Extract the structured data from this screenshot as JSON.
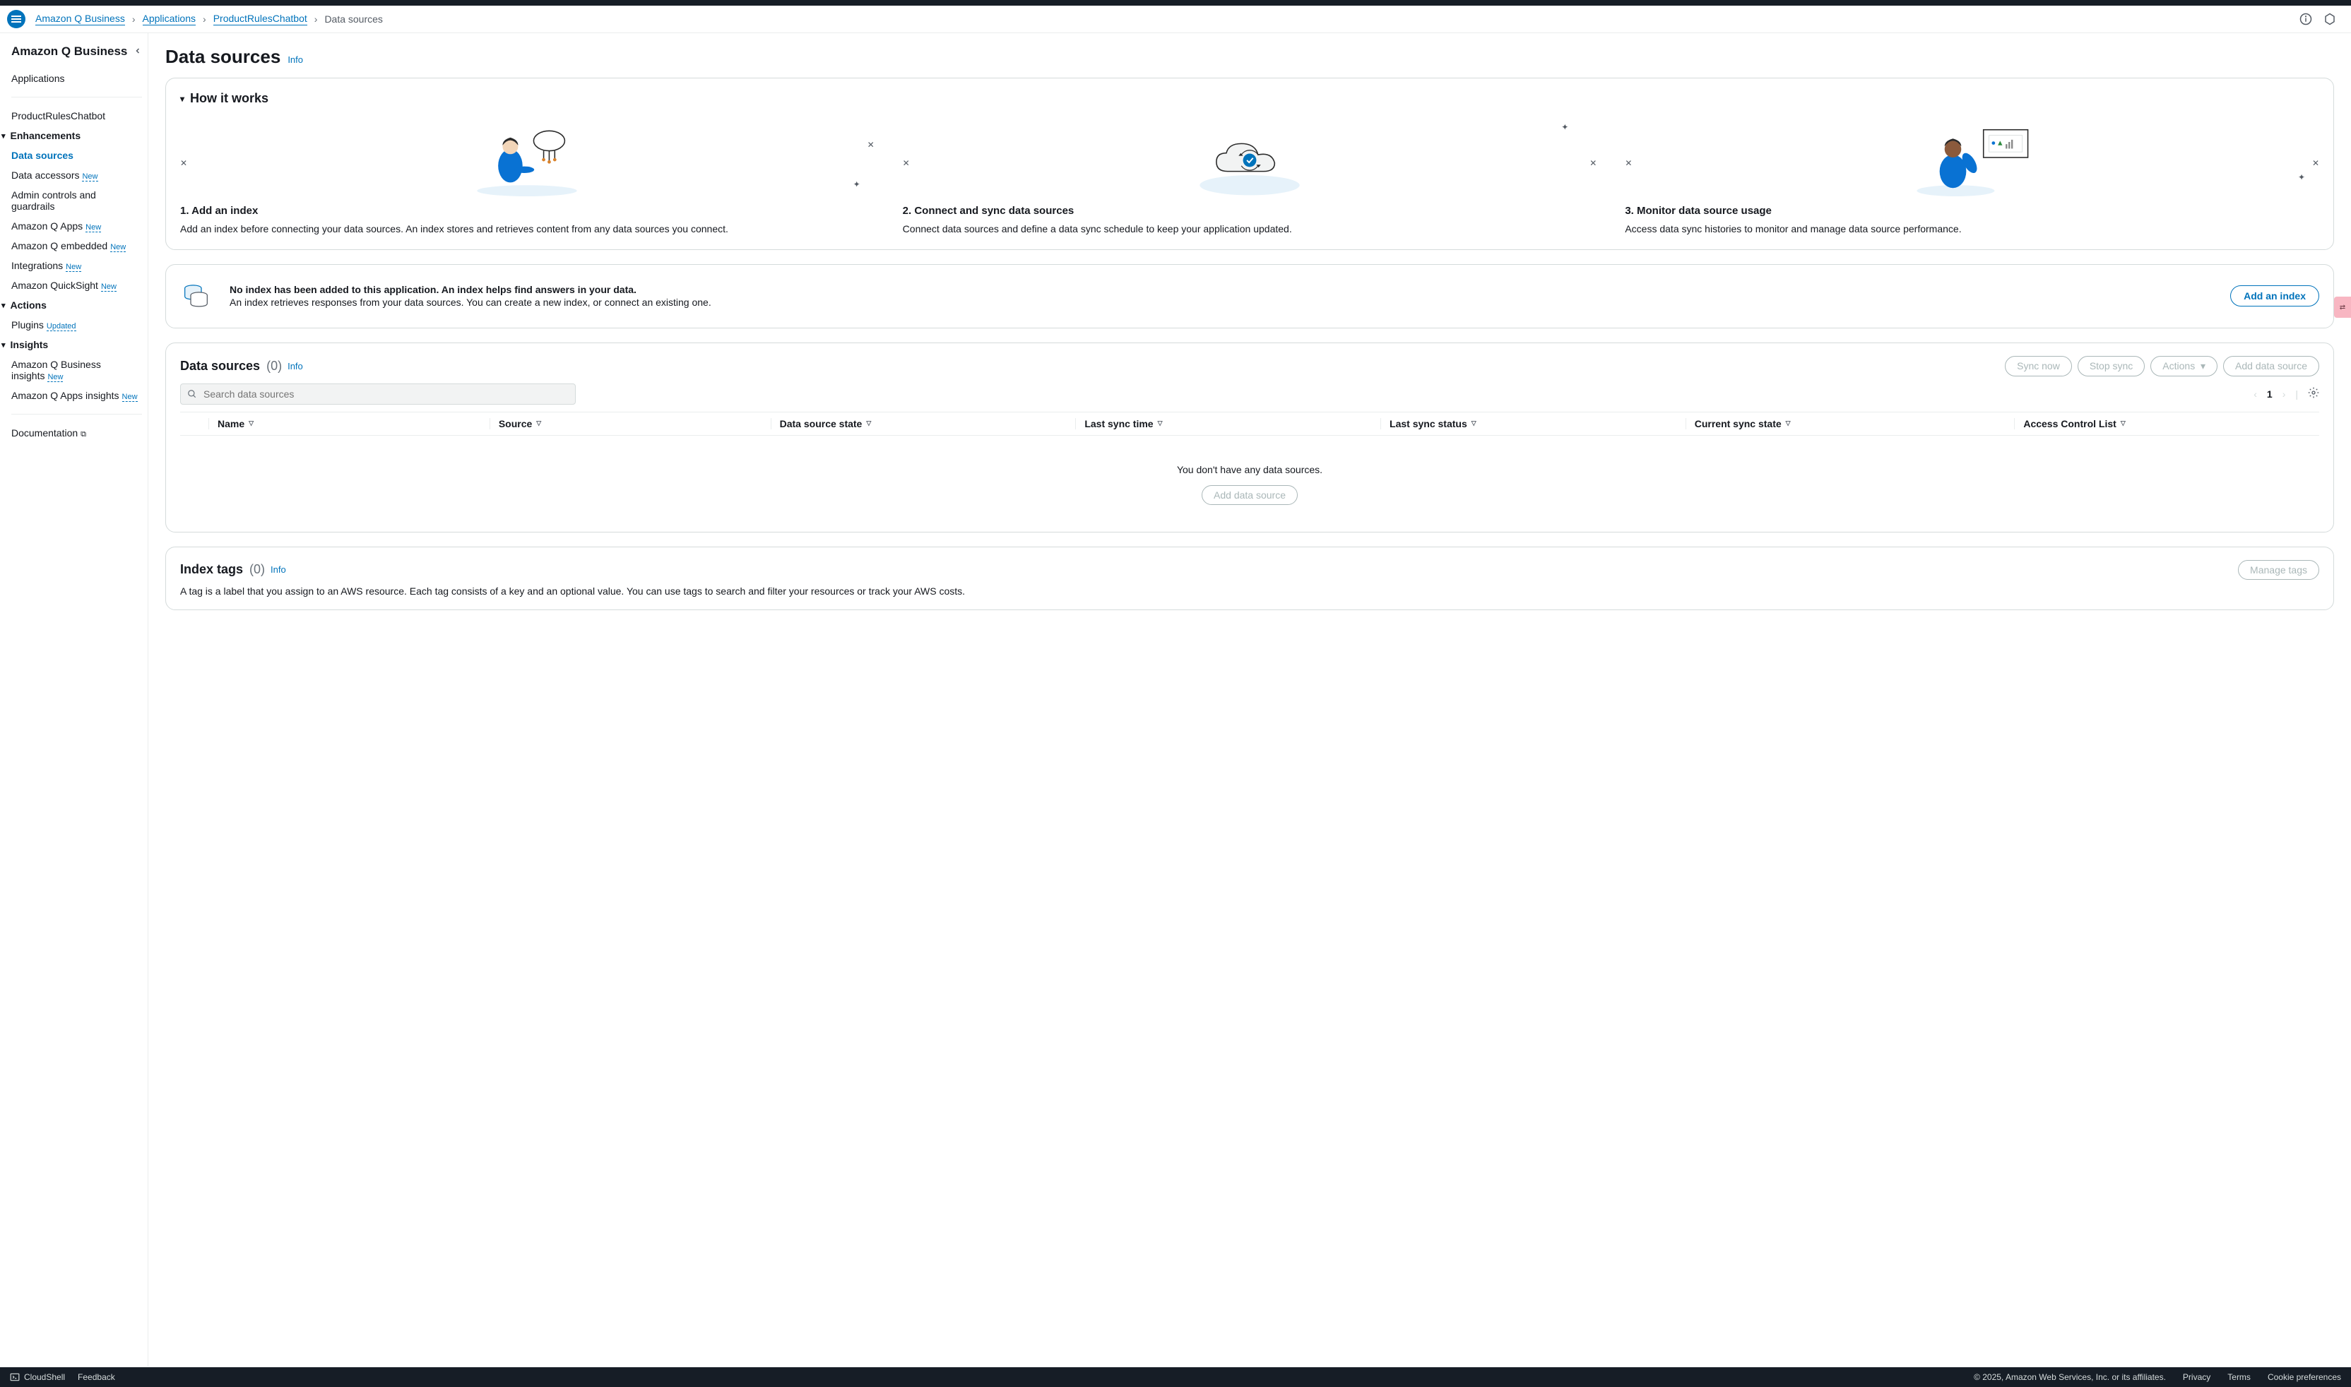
{
  "breadcrumb": {
    "root": "Amazon Q Business",
    "applications": "Applications",
    "app_name": "ProductRulesChatbot",
    "current": "Data sources"
  },
  "sidebar": {
    "title": "Amazon Q Business",
    "applications": "Applications",
    "app_name": "ProductRulesChatbot",
    "enhancements_label": "Enhancements",
    "enhancements": {
      "data_sources": "Data sources",
      "data_accessors": "Data accessors",
      "admin_controls": "Admin controls and guardrails",
      "amazon_q_apps": "Amazon Q Apps",
      "amazon_q_embedded": "Amazon Q embedded",
      "integrations": "Integrations",
      "quicksight": "Amazon QuickSight"
    },
    "actions_label": "Actions",
    "actions": {
      "plugins": "Plugins"
    },
    "insights_label": "Insights",
    "insights": {
      "qb_insights": "Amazon Q Business insights",
      "qa_insights": "Amazon Q Apps insights"
    },
    "documentation": "Documentation",
    "badge_new": "New",
    "badge_updated": "Updated"
  },
  "page": {
    "title": "Data sources",
    "info": "Info"
  },
  "how_it_works": {
    "heading": "How it works",
    "steps": [
      {
        "title": "1. Add an index",
        "body": "Add an index before connecting your data sources. An index stores and retrieves content from any data sources you connect."
      },
      {
        "title": "2. Connect and sync data sources",
        "body": "Connect data sources and define a data sync schedule to keep your application updated."
      },
      {
        "title": "3. Monitor data source usage",
        "body": "Access data sync histories to monitor and manage data source performance."
      }
    ]
  },
  "alert": {
    "title": "No index has been added to this application. An index helps find answers in your data.",
    "body": "An index retrieves responses from your data sources. You can create a new index, or connect an existing one.",
    "button": "Add an index"
  },
  "data_sources": {
    "heading": "Data sources",
    "count": "(0)",
    "info": "Info",
    "sync_now": "Sync now",
    "stop_sync": "Stop sync",
    "actions": "Actions",
    "add": "Add data source",
    "search_placeholder": "Search data sources",
    "page_num": "1",
    "columns": {
      "name": "Name",
      "source": "Source",
      "state": "Data source state",
      "last_sync_time": "Last sync time",
      "last_sync_status": "Last sync status",
      "current_sync_state": "Current sync state",
      "acl": "Access Control List"
    },
    "empty_msg": "You don't have any data sources.",
    "empty_button": "Add data source"
  },
  "index_tags": {
    "heading": "Index tags",
    "count": "(0)",
    "info": "Info",
    "manage": "Manage tags",
    "desc": "A tag is a label that you assign to an AWS resource. Each tag consists of a key and an optional value. You can use tags to search and filter your resources or track your AWS costs."
  },
  "footer": {
    "cloudshell": "CloudShell",
    "feedback": "Feedback",
    "copyright": "© 2025, Amazon Web Services, Inc. or its affiliates.",
    "privacy": "Privacy",
    "terms": "Terms",
    "cookie": "Cookie preferences"
  }
}
